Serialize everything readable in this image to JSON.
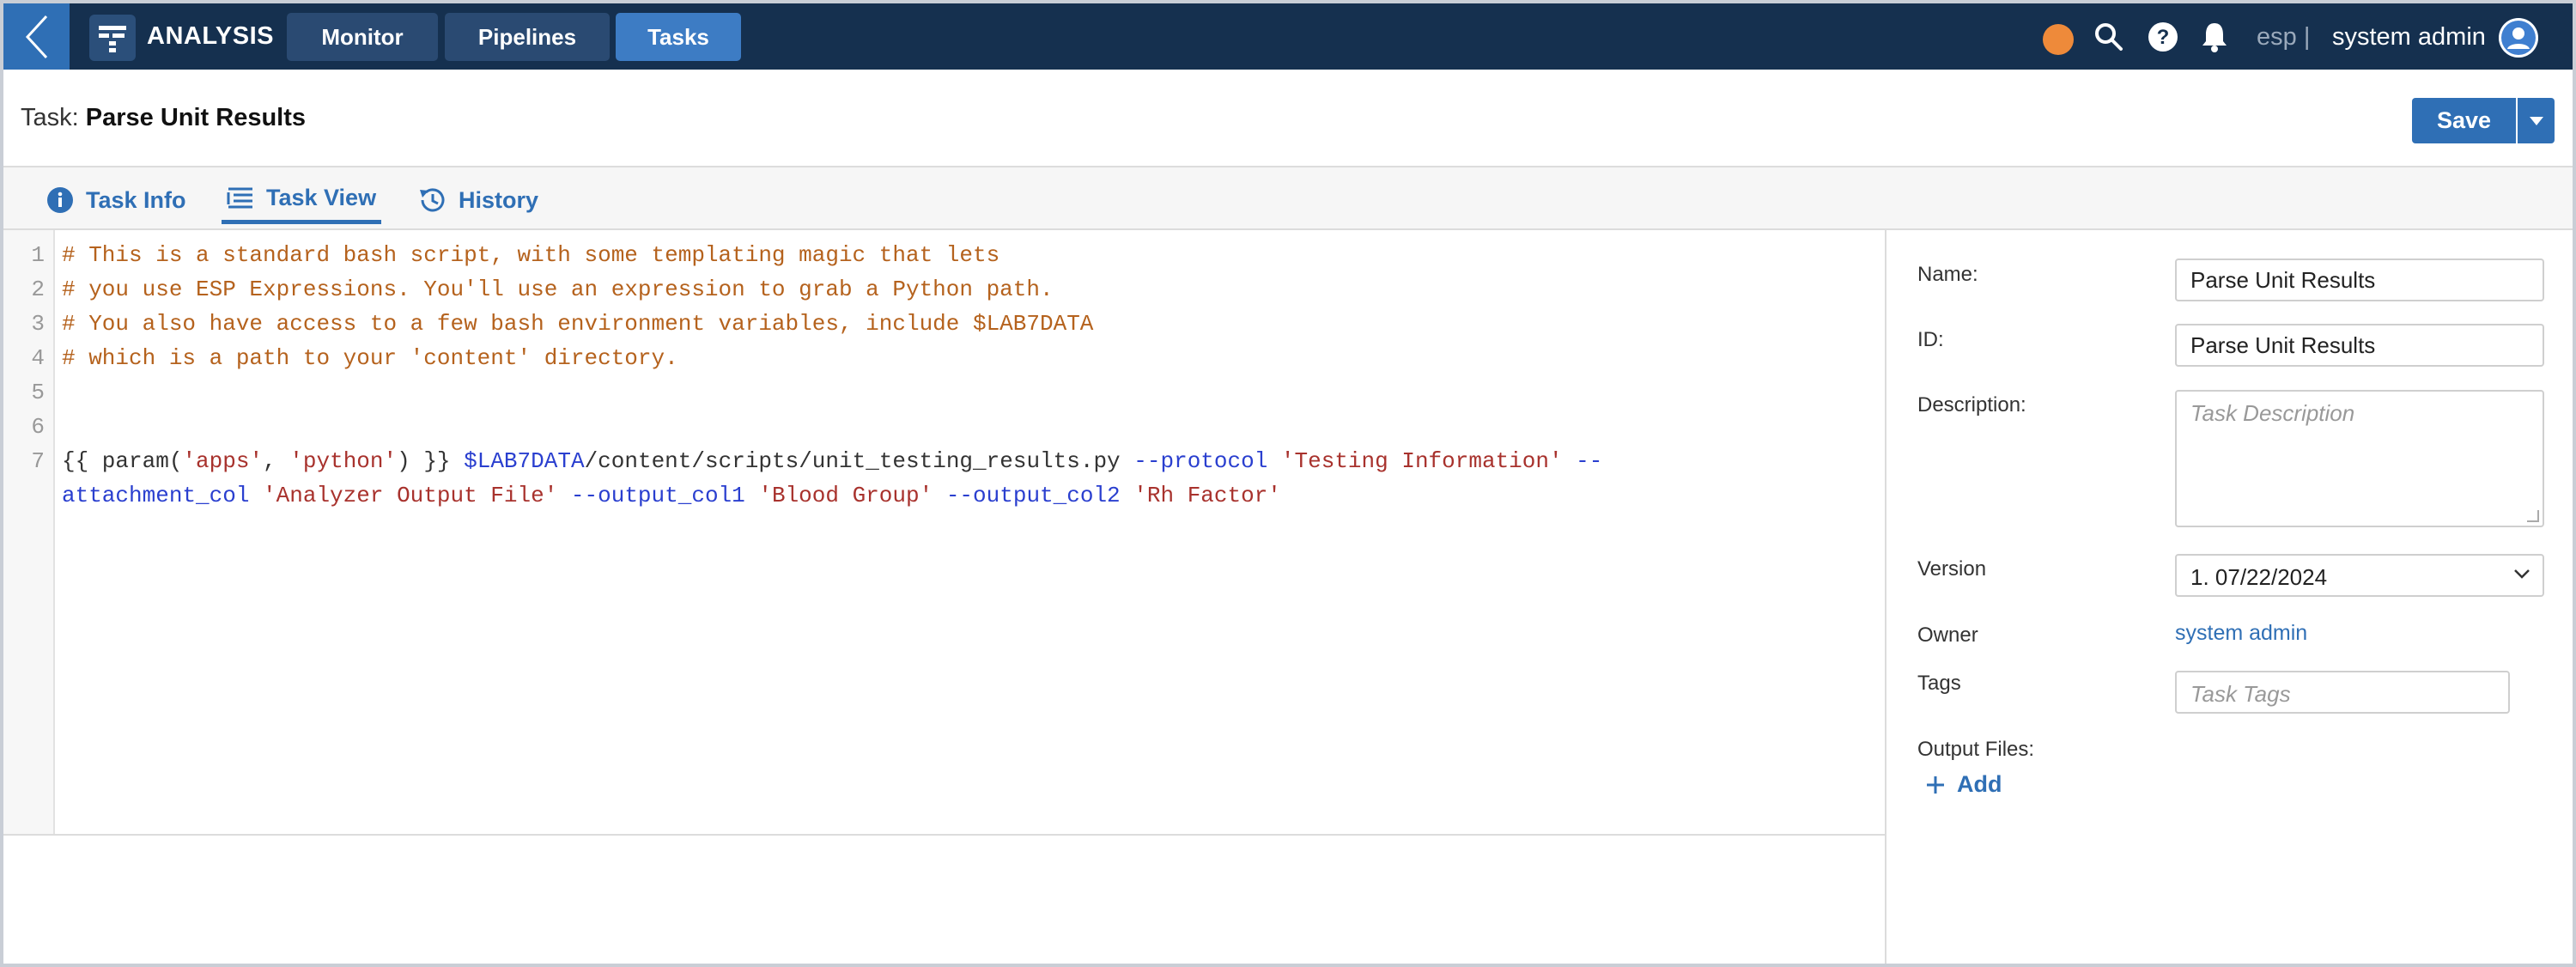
{
  "nav": {
    "app_name": "ANALYSIS",
    "tabs": [
      {
        "label": "Monitor"
      },
      {
        "label": "Pipelines"
      },
      {
        "label": "Tasks"
      }
    ],
    "active_tab": "Tasks",
    "env": "esp |",
    "user": "system admin",
    "status_color": "#ee8a3a"
  },
  "header": {
    "prefix": "Task:",
    "title": "Parse Unit Results",
    "save_label": "Save"
  },
  "tabs": [
    {
      "label": "Task Info",
      "icon": "info-icon"
    },
    {
      "label": "Task View",
      "icon": "list-icon"
    },
    {
      "label": "History",
      "icon": "history-icon"
    }
  ],
  "active_tab": "Task View",
  "editor": {
    "line_numbers": [
      "1",
      "2",
      "3",
      "4",
      "5",
      "6",
      "7"
    ],
    "lines": {
      "l1": "# This is a standard bash script, with some templating magic that lets",
      "l2": "# you use ESP Expressions. You'll use an expression to grab a Python path.",
      "l3": "# You also have access to a few bash environment variables, include $LAB7DATA",
      "l4": "# which is a path to your 'content' directory.",
      "l7": {
        "t1": "{{ param(",
        "t2": "'apps'",
        "t3": ", ",
        "t4": "'python'",
        "t5": ") }} ",
        "t6": "$LAB7DATA",
        "t7": "/content/scripts/unit_testing_results.py ",
        "t8": "--protocol",
        "t9": " ",
        "t10": "'Testing Information'",
        "t11": " --",
        "w1": "attachment_col",
        "w2": " ",
        "w3": "'Analyzer Output File'",
        "w4": " ",
        "w5": "--output_col1",
        "w6": " ",
        "w7": "'Blood Group'",
        "w8": " ",
        "w9": "--output_col2",
        "w10": " ",
        "w11": "'Rh Factor'"
      }
    }
  },
  "side": {
    "name_label": "Name:",
    "name_value": "Parse Unit Results",
    "id_label": "ID:",
    "id_value": "Parse Unit Results",
    "description_label": "Description:",
    "description_placeholder": "Task Description",
    "version_label": "Version",
    "version_value": "1. 07/22/2024",
    "owner_label": "Owner",
    "owner_value": "system admin",
    "tags_label": "Tags",
    "tags_placeholder": "Task Tags",
    "output_files_label": "Output Files:",
    "add_label": "Add"
  },
  "colors": {
    "nav_bg": "#15304f",
    "accent": "#2f6fb5",
    "comment": "#b5621d",
    "string": "#a8322d",
    "keyword": "#2a3fcf"
  }
}
